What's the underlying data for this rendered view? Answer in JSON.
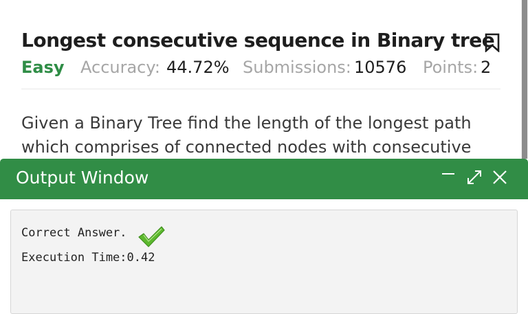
{
  "problem": {
    "title": "Longest consecutive sequence in Binary tree",
    "difficulty": "Easy",
    "accuracy_label": "Accuracy:",
    "accuracy_value": "44.72%",
    "submissions_label": "Submissions:",
    "submissions_value": "10576",
    "points_label": "Points:",
    "points_value": "2",
    "description_lines": [
      "Given a Binary Tree find the length of the longest path",
      "which comprises of connected nodes with consecutive"
    ]
  },
  "output_window": {
    "title": "Output Window",
    "result_text": "Correct Answer.",
    "execution_time": "Execution Time:0.42"
  },
  "icons": {
    "bookmark": "bookmark-icon",
    "minimize": "minimize-icon",
    "expand": "expand-icon",
    "close": "close-icon",
    "check": "checkmark-icon"
  },
  "colors": {
    "accent_green": "#2f8d46",
    "header_green": "#318d46",
    "muted_text": "#a6a6a6",
    "check_green": "#5cb82e"
  }
}
